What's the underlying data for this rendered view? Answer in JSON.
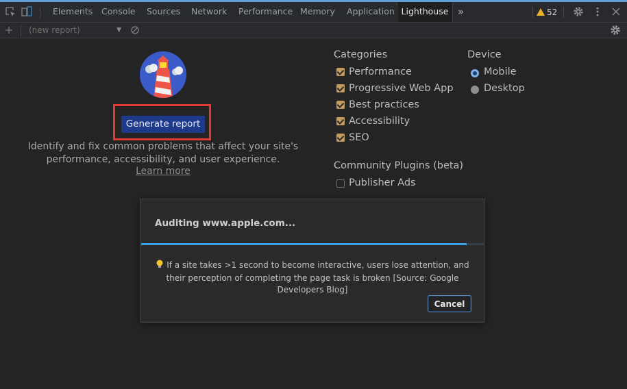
{
  "tabs": [
    {
      "label": "Elements"
    },
    {
      "label": "Console"
    },
    {
      "label": "Sources"
    },
    {
      "label": "Network"
    },
    {
      "label": "Performance"
    },
    {
      "label": "Memory"
    },
    {
      "label": "Application"
    },
    {
      "label": "Lighthouse",
      "active": true
    }
  ],
  "warnings": {
    "count": "52",
    "icon": "warning-triangle-icon",
    "color": "#e8b224"
  },
  "toolbar": {
    "report_select": "(new report)"
  },
  "main": {
    "generate_label": "Generate report",
    "description": "Identify and fix common problems that affect your site's performance, accessibility, and user experience.",
    "learn_more": "Learn more"
  },
  "categories": {
    "title": "Categories",
    "items": [
      {
        "label": "Performance",
        "checked": true
      },
      {
        "label": "Progressive Web App",
        "checked": true
      },
      {
        "label": "Best practices",
        "checked": true
      },
      {
        "label": "Accessibility",
        "checked": true
      },
      {
        "label": "SEO",
        "checked": true
      }
    ]
  },
  "device": {
    "title": "Device",
    "options": [
      {
        "label": "Mobile",
        "selected": true
      },
      {
        "label": "Desktop",
        "selected": false
      }
    ]
  },
  "plugins": {
    "title": "Community Plugins (beta)",
    "items": [
      {
        "label": "Publisher Ads",
        "checked": false
      }
    ]
  },
  "dialog": {
    "title": "Auditing www.apple.com...",
    "progress": 0.95,
    "tip": "If a site takes >1 second to become interactive, users lose attention, and their perception of completing the page task is broken [Source: Google Developers Blog]",
    "cancel_label": "Cancel"
  },
  "colors": {
    "accent": "#3b9fe6",
    "primary_button": "#1e3a8a",
    "highlight_box": "#e53935",
    "checkbox": "#c29b5f"
  }
}
